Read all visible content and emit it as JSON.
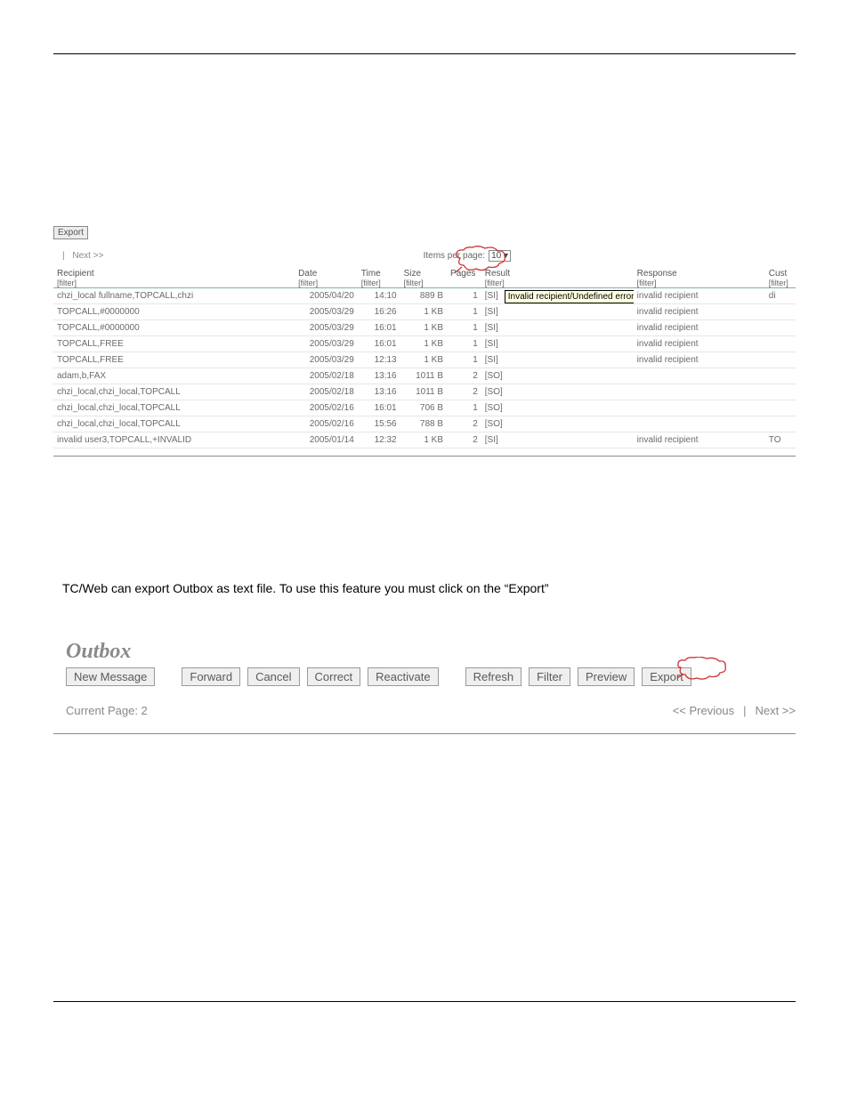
{
  "screenshot": {
    "export_button": "Export",
    "pager_prev_sep": "|",
    "pager_next": "Next >>",
    "items_per_page_label": "Items per page:",
    "items_per_page_value": "10",
    "tooltip_text": "Invalid recipient/Undefined error code",
    "columns": {
      "recipient": "Recipient",
      "date": "Date",
      "time": "Time",
      "size": "Size",
      "pages": "Pages",
      "result": "Result",
      "response": "Response",
      "cust": "Cust",
      "filter_sub": "[filter]"
    },
    "rows": [
      {
        "recipient": "chzi_local fullname,TOPCALL,chzi",
        "date": "2005/04/20",
        "time": "14:10",
        "size": "889 B",
        "pages": "1",
        "result": "[SI]",
        "response": "invalid recipient",
        "cust": "di"
      },
      {
        "recipient": "TOPCALL,#0000000",
        "date": "2005/03/29",
        "time": "16:26",
        "size": "1 KB",
        "pages": "1",
        "result": "[SI]",
        "response": "invalid recipient",
        "cust": ""
      },
      {
        "recipient": "TOPCALL,#0000000",
        "date": "2005/03/29",
        "time": "16:01",
        "size": "1 KB",
        "pages": "1",
        "result": "[SI]",
        "response": "invalid recipient",
        "cust": ""
      },
      {
        "recipient": "TOPCALL,FREE",
        "date": "2005/03/29",
        "time": "16:01",
        "size": "1 KB",
        "pages": "1",
        "result": "[SI]",
        "response": "invalid recipient",
        "cust": ""
      },
      {
        "recipient": "TOPCALL,FREE",
        "date": "2005/03/29",
        "time": "12:13",
        "size": "1 KB",
        "pages": "1",
        "result": "[SI]",
        "response": "invalid recipient",
        "cust": ""
      },
      {
        "recipient": "adam,b,FAX",
        "date": "2005/02/18",
        "time": "13:16",
        "size": "1011 B",
        "pages": "2",
        "result": "[SO]",
        "response": "",
        "cust": ""
      },
      {
        "recipient": "chzi_local,chzi_local,TOPCALL",
        "date": "2005/02/18",
        "time": "13:16",
        "size": "1011 B",
        "pages": "2",
        "result": "[SO]",
        "response": "",
        "cust": ""
      },
      {
        "recipient": "chzi_local,chzi_local,TOPCALL",
        "date": "2005/02/16",
        "time": "16:01",
        "size": "706 B",
        "pages": "1",
        "result": "[SO]",
        "response": "",
        "cust": ""
      },
      {
        "recipient": "chzi_local,chzi_local,TOPCALL",
        "date": "2005/02/16",
        "time": "15:56",
        "size": "788 B",
        "pages": "2",
        "result": "[SO]",
        "response": "",
        "cust": ""
      },
      {
        "recipient": "invalid user3,TOPCALL,+INVALID",
        "date": "2005/01/14",
        "time": "12:32",
        "size": "1 KB",
        "pages": "2",
        "result": "[SI]",
        "response": "invalid recipient",
        "cust": "TO"
      }
    ]
  },
  "body_text": "TC/Web can export Outbox as text file. To use this feature you must click on the “Export”",
  "toolbar": {
    "heading": "Outbox",
    "new_message": "New Message",
    "forward": "Forward",
    "cancel": "Cancel",
    "correct": "Correct",
    "reactivate": "Reactivate",
    "refresh": "Refresh",
    "filter": "Filter",
    "preview": "Preview",
    "export": "Export",
    "current_page_label": "Current Page: 2",
    "prev": "<< Previous",
    "sep": "|",
    "next": "Next >>"
  }
}
